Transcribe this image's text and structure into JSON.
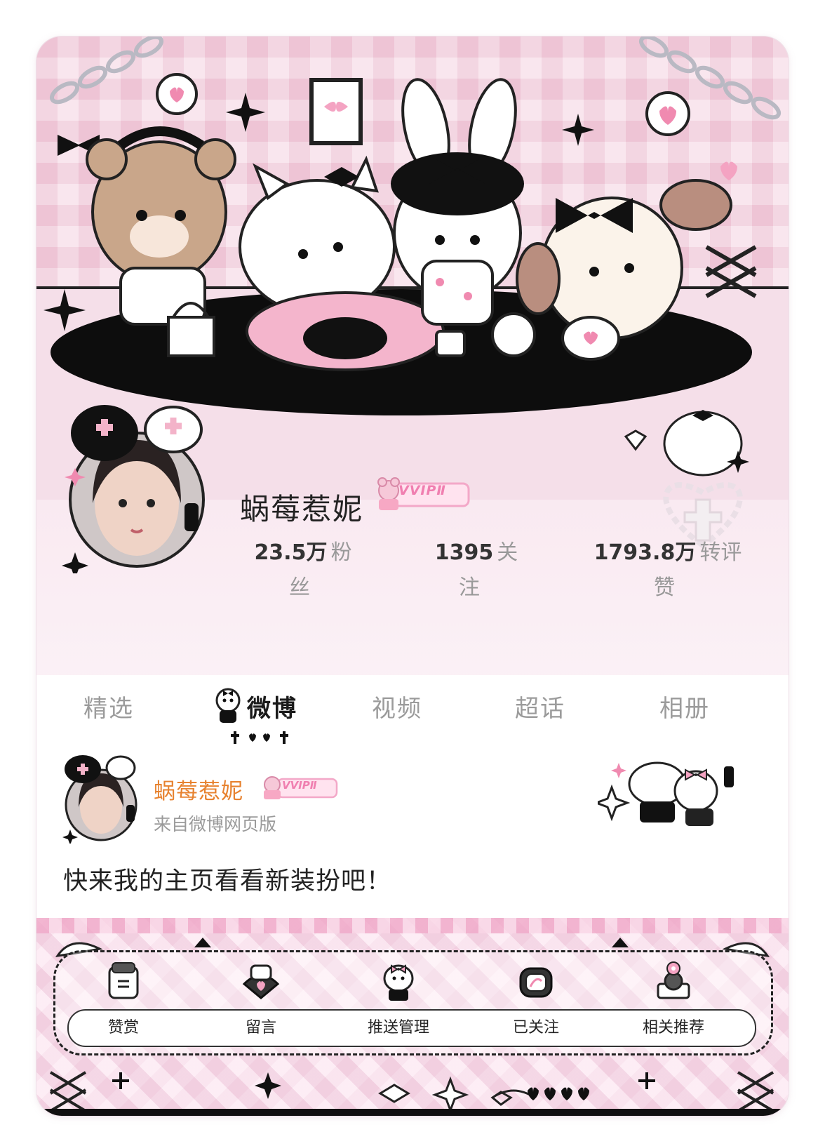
{
  "profile": {
    "name": "蜗莓惹妮",
    "vip_label": "VVIPⅡ",
    "stats": [
      {
        "number": "23.5万",
        "label_a": "粉",
        "label_b": "丝"
      },
      {
        "number": "1395",
        "label_a": "关",
        "label_b": "注"
      },
      {
        "number": "1793.8万",
        "label_a": "转评",
        "label_b": "赞"
      }
    ]
  },
  "tabs": [
    {
      "label": "精选"
    },
    {
      "label": "微博"
    },
    {
      "label": "视频"
    },
    {
      "label": "超话"
    },
    {
      "label": "相册"
    }
  ],
  "post": {
    "author": "蜗莓惹妮",
    "vip_label": "VVIPⅡ",
    "source": "来自微博网页版",
    "text": "快来我的主页看看新装扮吧！"
  },
  "actions": [
    {
      "label": "赞赏",
      "icon": "reward-icon"
    },
    {
      "label": "留言",
      "icon": "message-icon"
    },
    {
      "label": "推送管理",
      "icon": "push-settings-icon"
    },
    {
      "label": "已关注",
      "icon": "followed-icon"
    },
    {
      "label": "相关推荐",
      "icon": "recommend-icon"
    }
  ],
  "colors": {
    "accent_orange": "#e7822f",
    "pink": "#f07fb0",
    "header_bg": "#f6dbe6"
  }
}
